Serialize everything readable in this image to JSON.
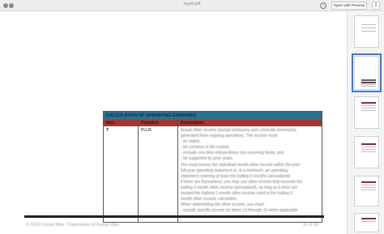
{
  "window": {
    "title": "myof.pdf",
    "open_with_preview_label": "Open with Preview",
    "info_icon": "info-icon",
    "share_icon": "share-icon"
  },
  "table": {
    "title": "CALCULATION OF OPERATING EXPENSES",
    "headers": [
      "Item",
      "Function",
      "Description"
    ],
    "row": {
      "item": "7",
      "function": "PLUS",
      "description": "Actual other income (except premiums and corporate premiums)\ngenerated from ongoing operations.  The income must:\n- be stable,\n- be common in the market,\n- exclude one-time extraordinary non-recurring items, and\n- be supported by prior years.\nYou must assess the individual month other income within the prior\nfull-year operating statement or, at a minimum, an operating\nstatement covering at least the trailing 6 months (annualized).\nIf there are fluctuations, you may use other income that exceeds the\ntrailing 3-month other income (annualized), as long as it does not\nexceed the highest 1-month other income used in the trailing 3\nmonth other income calculation.\nWhen determining the other income, you must:\n- include specific income for items 13 through 15 when applicable"
    }
  },
  "footer": {
    "text": "© 2019 Fannie Mae. Trademarks of Fannie Mae.",
    "page": "11 of 32"
  },
  "sidebar": {
    "thumbnail_count": 6,
    "selected_index": 1
  }
}
